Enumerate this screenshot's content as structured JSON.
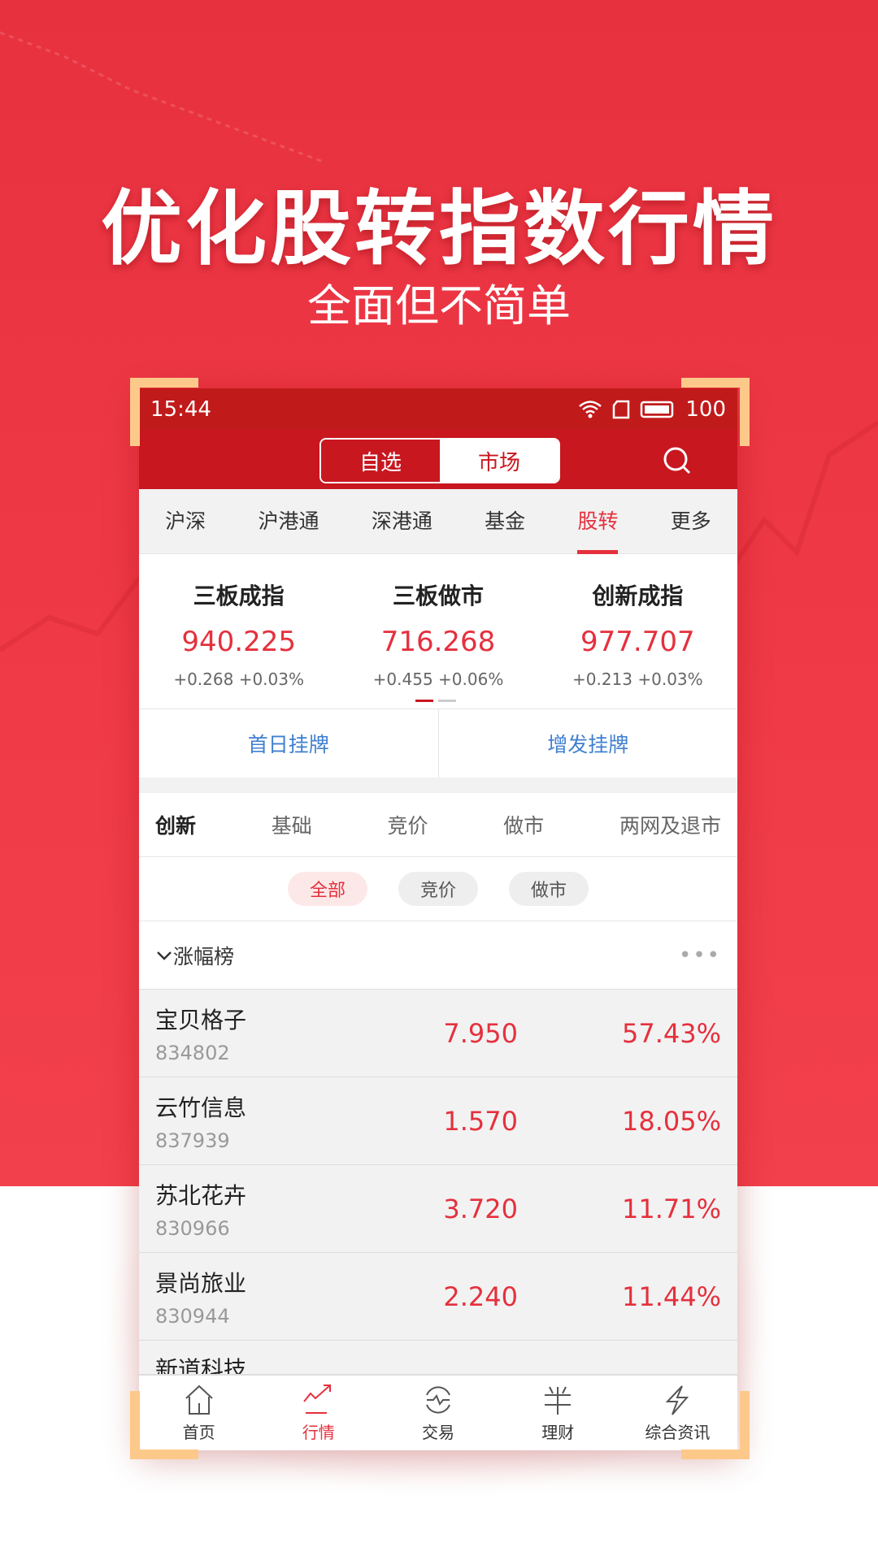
{
  "promo": {
    "headline": "优化股转指数行情",
    "subtitle": "全面但不简单"
  },
  "status": {
    "time": "15:44",
    "battery": "100"
  },
  "header": {
    "segments": [
      "自选",
      "市场"
    ],
    "active_segment": "市场"
  },
  "market_tabs": [
    "沪深",
    "沪港通",
    "深港通",
    "基金",
    "股转",
    "更多"
  ],
  "active_market_tab": "股转",
  "indices": [
    {
      "name": "三板成指",
      "value": "940.225",
      "change": "+0.268",
      "pct": "+0.03%"
    },
    {
      "name": "三板做市",
      "value": "716.268",
      "change": "+0.455",
      "pct": "+0.06%"
    },
    {
      "name": "创新成指",
      "value": "977.707",
      "change": "+0.213",
      "pct": "+0.03%"
    }
  ],
  "listing": [
    "首日挂牌",
    "增发挂牌"
  ],
  "sub_tabs": [
    "创新",
    "基础",
    "竞价",
    "做市",
    "两网及退市"
  ],
  "active_sub_tab": "创新",
  "chips": [
    "全部",
    "竞价",
    "做市"
  ],
  "active_chip": "全部",
  "ranking": {
    "title": "涨幅榜",
    "more": "•••",
    "rows": [
      {
        "name": "宝贝格子",
        "code": "834802",
        "price": "7.950",
        "pct": "57.43%"
      },
      {
        "name": "云竹信息",
        "code": "837939",
        "price": "1.570",
        "pct": "18.05%"
      },
      {
        "name": "苏北花卉",
        "code": "830966",
        "price": "3.720",
        "pct": "11.71%"
      },
      {
        "name": "景尚旅业",
        "code": "830944",
        "price": "2.240",
        "pct": "11.44%"
      },
      {
        "name": "新道科技",
        "code": "",
        "price": "",
        "pct": ""
      }
    ]
  },
  "nav": [
    "首页",
    "行情",
    "交易",
    "理财",
    "综合资讯"
  ],
  "active_nav": "行情",
  "colors": {
    "brand_red": "#c8171f",
    "up_red": "#e5303d",
    "link_blue": "#3f7fd0",
    "corner": "#fcc98a"
  }
}
